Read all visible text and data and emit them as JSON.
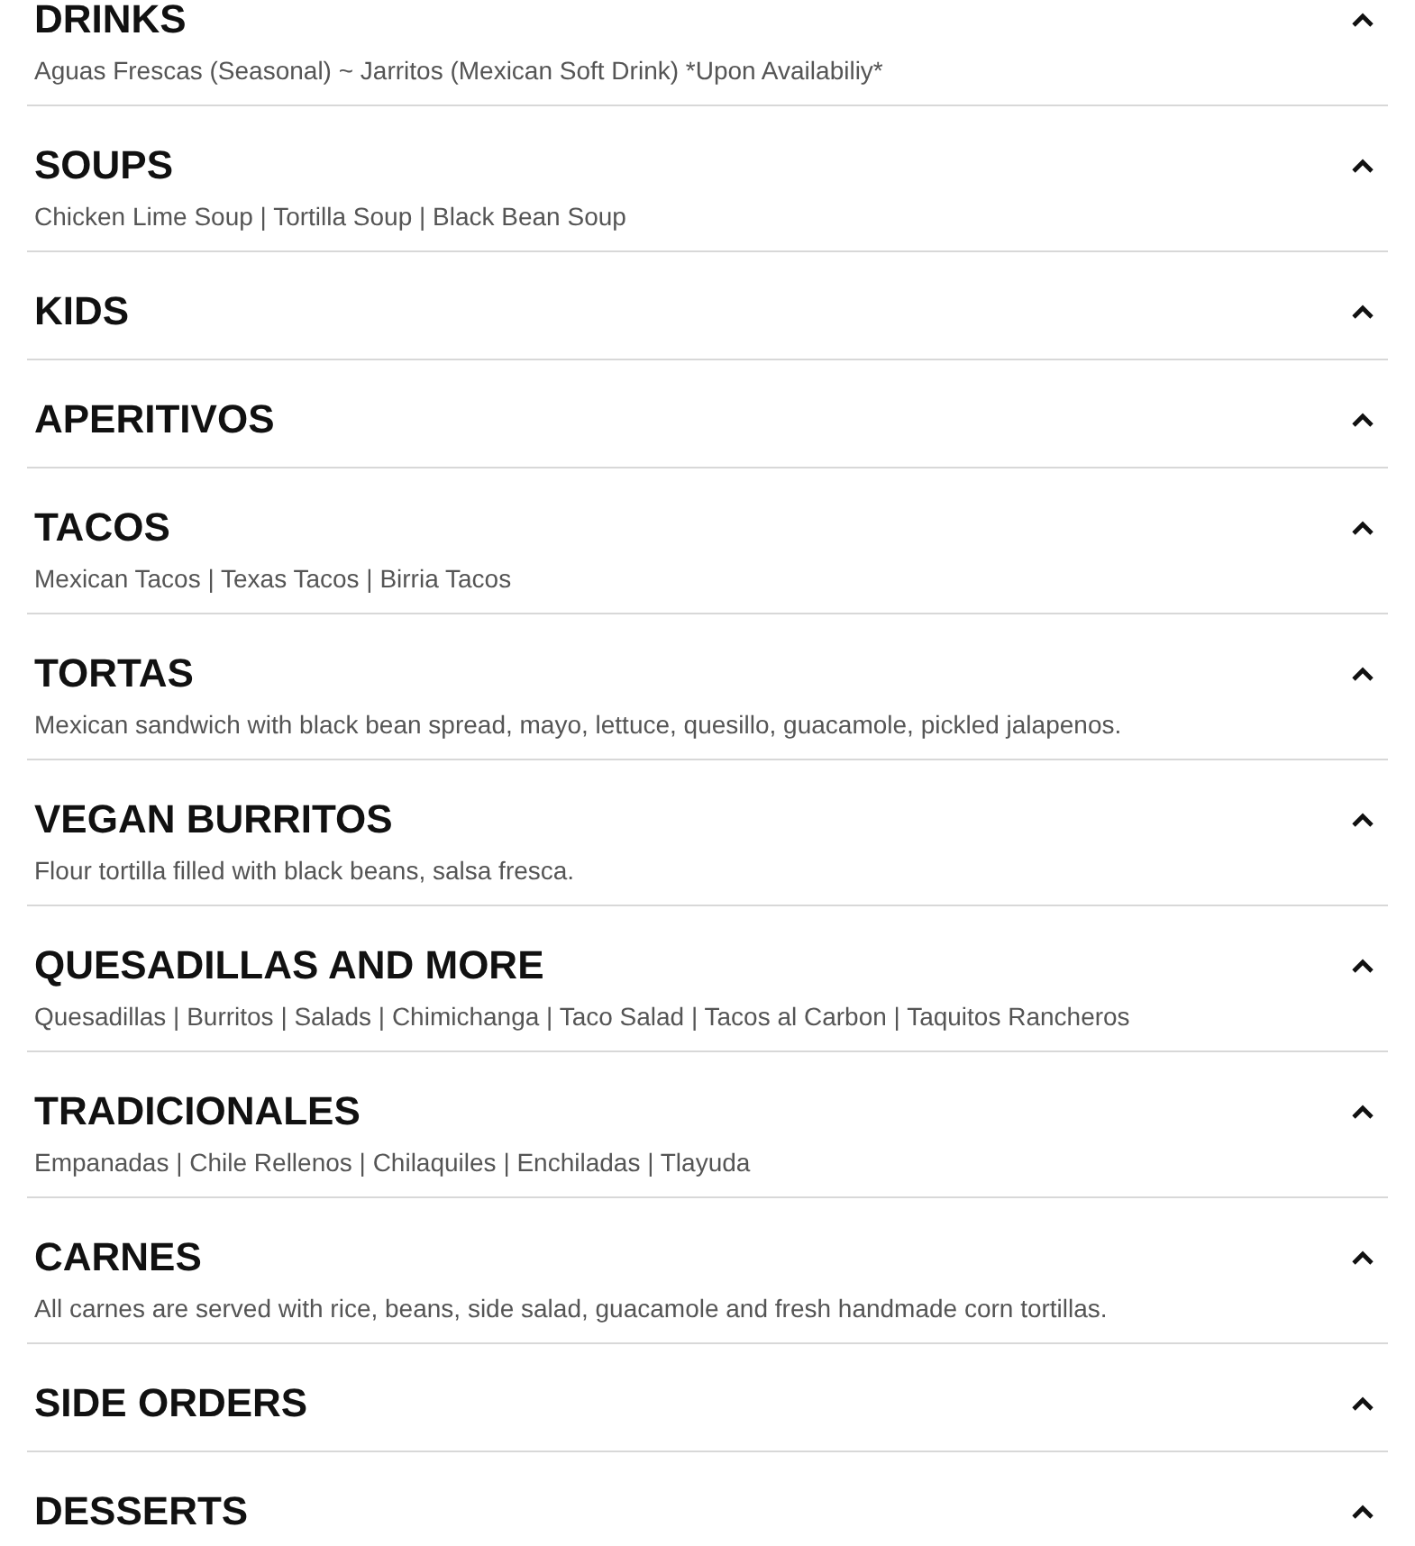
{
  "menu_sections": [
    {
      "title": "DRINKS",
      "description": "Aguas Frescas (Seasonal) ~ Jarritos (Mexican Soft Drink) *Upon Availabiliy*",
      "expanded": true
    },
    {
      "title": "SOUPS",
      "description": "Chicken Lime Soup | Tortilla Soup | Black Bean Soup",
      "expanded": true
    },
    {
      "title": "KIDS",
      "expanded": true
    },
    {
      "title": "APERITIVOS",
      "expanded": true
    },
    {
      "title": "TACOS",
      "description": "Mexican Tacos | Texas Tacos | Birria Tacos",
      "expanded": true
    },
    {
      "title": "TORTAS",
      "description": "Mexican sandwich with black bean spread, mayo, lettuce, quesillo, guacamole, pickled jalapenos.",
      "expanded": true
    },
    {
      "title": "VEGAN BURRITOS",
      "description": "Flour tortilla filled with black beans, salsa fresca.",
      "expanded": true
    },
    {
      "title": "QUESADILLAS AND MORE",
      "description": "Quesadillas | Burritos | Salads | Chimichanga | Taco Salad | Tacos al Carbon | Taquitos Rancheros",
      "expanded": true
    },
    {
      "title": "TRADICIONALES",
      "description": "Empanadas | Chile Rellenos | Chilaquiles | Enchiladas | Tlayuda",
      "expanded": true
    },
    {
      "title": "CARNES",
      "description": "All carnes are served with rice, beans, side salad, guacamole and fresh handmade corn tortillas.",
      "expanded": true
    },
    {
      "title": "SIDE ORDERS",
      "expanded": true
    },
    {
      "title": "DESSERTS",
      "expanded": true
    }
  ]
}
